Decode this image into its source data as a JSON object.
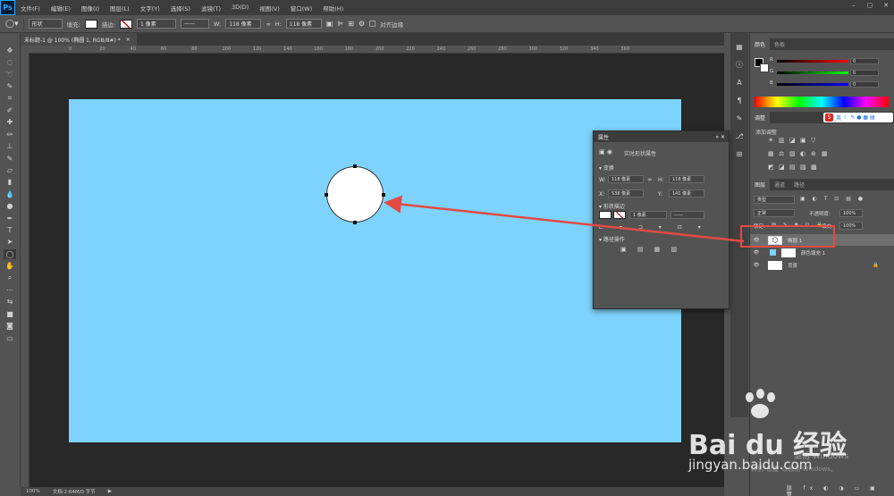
{
  "app": {
    "logo": "Ps"
  },
  "menu": [
    "文件(F)",
    "编辑(E)",
    "图像(I)",
    "图层(L)",
    "文字(Y)",
    "选择(S)",
    "滤镜(T)",
    "3D(D)",
    "视图(V)",
    "窗口(W)",
    "帮助(H)"
  ],
  "options": {
    "mode": "形状",
    "fill_label": "填充:",
    "stroke_label": "描边:",
    "stroke_width": "1 像素",
    "w_label": "W:",
    "w_value": "118 像素",
    "link": "∞",
    "h_label": "H:",
    "h_value": "118 像素",
    "align_edges": "对齐边缘"
  },
  "document": {
    "tab_title": "未标题-1 @ 100% (椭圆 1, RGB/8#) *",
    "close": "×"
  },
  "ruler": {
    "top_ticks": [
      "0",
      "20",
      "40",
      "60",
      "80",
      "100",
      "120",
      "140",
      "160",
      "180",
      "200",
      "220",
      "240",
      "260",
      "280",
      "300",
      "320",
      "340",
      "360"
    ]
  },
  "status": {
    "zoom": "100%",
    "doc": "文档:2.64M/0 字节"
  },
  "panels": {
    "color_tabs": [
      "颜色",
      "色板"
    ],
    "color_rows": [
      {
        "label": "R",
        "value": "0"
      },
      {
        "label": "G",
        "value": "0"
      },
      {
        "label": "B",
        "value": "0"
      }
    ],
    "adjust_tab": "调整",
    "adjust_add": "添加调整",
    "layers_tabs": [
      "图层",
      "通道",
      "路径"
    ],
    "layer_kind": "类型",
    "blend_mode": "正常",
    "opacity_label": "不透明度:",
    "opacity_value": "100%",
    "lock_label": "锁定:",
    "fill_label": "填充:",
    "fill_value": "100%",
    "layers": [
      {
        "name": "椭圆 1"
      },
      {
        "name": "颜色填充 1"
      },
      {
        "name": "背景"
      }
    ]
  },
  "properties": {
    "title": "属性",
    "subtitle": "实时形状属性",
    "section_transform": "变换",
    "w_label": "W:",
    "w_value": "118 像素",
    "h_label": "H:",
    "h_value": "118 像素",
    "x_label": "X:",
    "x_value": "538 像素",
    "y_label": "Y:",
    "y_value": "141 像素",
    "section_shape": "形状描边",
    "stroke_width": "1 像素",
    "section_path": "路径操作"
  },
  "ime": {
    "label": "英"
  },
  "watermark": {
    "brand": "Bai du 经验",
    "url": "jingyan.baidu.com",
    "activate": "激活 Windows",
    "activate_sub": "转到\"设置\"以激活 Windows。"
  },
  "colors": {
    "canvas": "#7dd3fb",
    "accent_red": "#e24b44"
  }
}
